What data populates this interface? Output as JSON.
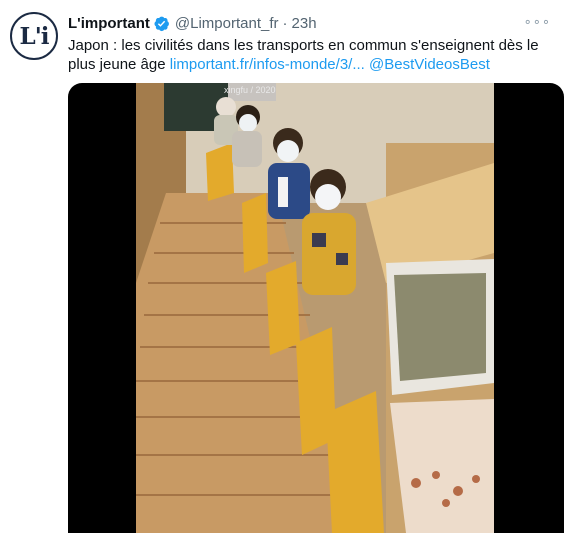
{
  "tweet": {
    "display_name": "L'important",
    "handle": "@Limportant_fr",
    "separator": "·",
    "time": "23h",
    "more_label": "∘∘∘",
    "text_main": "Japon : les civilités dans les transports en commun s'enseignent dès le plus jeune âge ",
    "link_url": "limportant.fr/infos-monde/3/...",
    "mention": "@BestVideosBest",
    "avatar_logo": "L'i"
  },
  "media": {
    "watermark": "xingfu / 2020"
  },
  "colors": {
    "link": "#1d9bf0",
    "verified": "#1d9bf0",
    "secondary_text": "#536471"
  }
}
